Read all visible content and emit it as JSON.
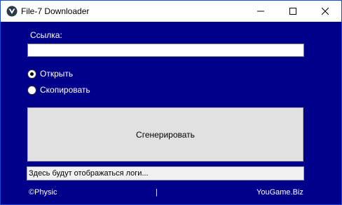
{
  "window": {
    "title": "File-7 Downloader",
    "icon": "app-logo-icon",
    "controls": {
      "minimize_icon": "minimize-icon",
      "maximize_icon": "maximize-icon",
      "close_icon": "close-icon"
    }
  },
  "form": {
    "link_label": "Ссылка:",
    "link_value": "",
    "link_placeholder": "",
    "options": [
      {
        "label": "Открыть",
        "selected": true
      },
      {
        "label": "Скопировать",
        "selected": false
      }
    ],
    "generate_label": "Сгенерировать",
    "log_text": "Здесь будут отображаться логи..."
  },
  "footer": {
    "left_text": "©Physic",
    "separator": "|",
    "right_text": "YouGame.Biz"
  },
  "colors": {
    "background": "#00008B",
    "button": "#E1E1E1",
    "log_box": "#F0F0F0",
    "text_on_background": "#FFFFFF"
  }
}
